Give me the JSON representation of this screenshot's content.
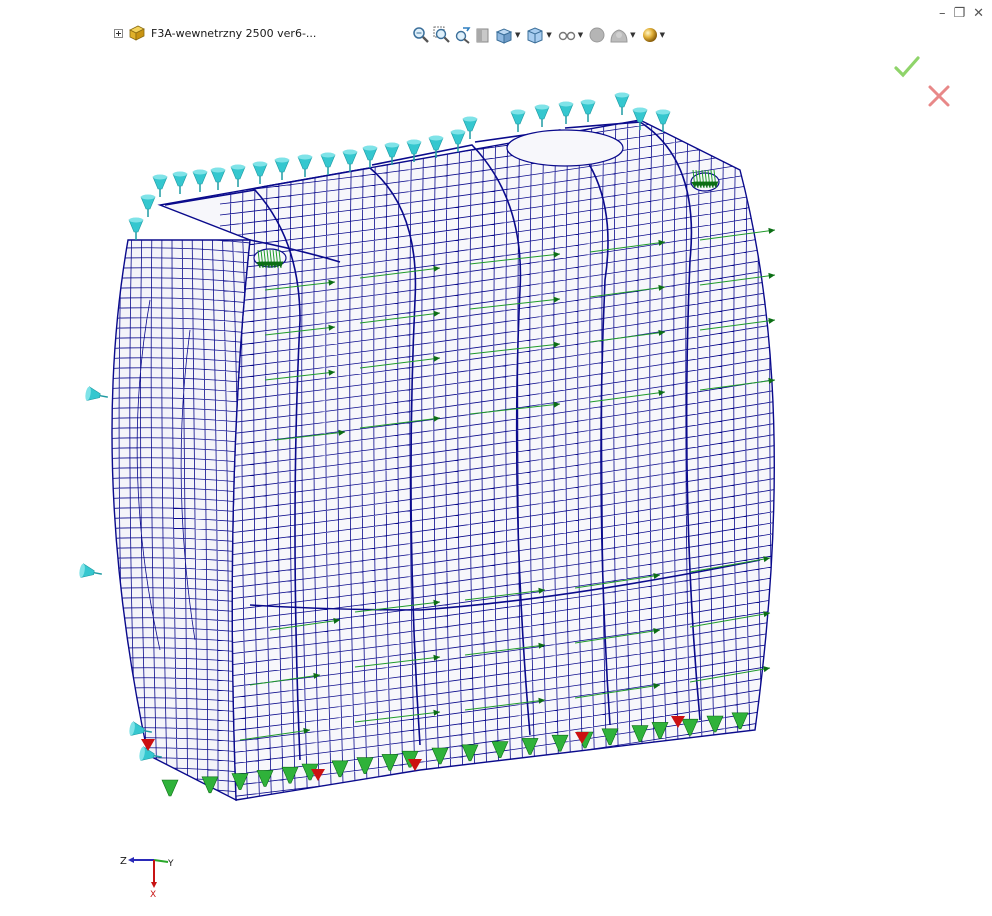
{
  "window": {
    "controls": {
      "minimize": "–",
      "restore": "❐",
      "close": "✕"
    }
  },
  "tree": {
    "part_label": "F3A-wewnetrzny 2500 ver6-..."
  },
  "toolbar": {
    "icons": [
      "zoom-to-fit-icon",
      "zoom-to-area-icon",
      "previous-view-icon",
      "section-view-icon",
      "view-orientation-icon",
      "display-style-icon",
      "hide-show-items-icon",
      "edit-appearance-icon",
      "apply-scene-icon",
      "view-settings-icon"
    ]
  },
  "confirm": {
    "accept": "✓",
    "cancel": "✕"
  },
  "triad": {
    "z": "Z",
    "y": "Y",
    "x": "X"
  },
  "colors": {
    "background": "#ffffff",
    "mesh_line": "#0a0a8c",
    "mesh_fill": "#f7f7fb",
    "fixture": "#35c7cf",
    "force_arrow": "#1f9b2a",
    "force_dark": "#0c6e15",
    "restraint_red": "#cc1111",
    "accept_green": "#8fd46a",
    "cancel_red": "#e88888"
  }
}
